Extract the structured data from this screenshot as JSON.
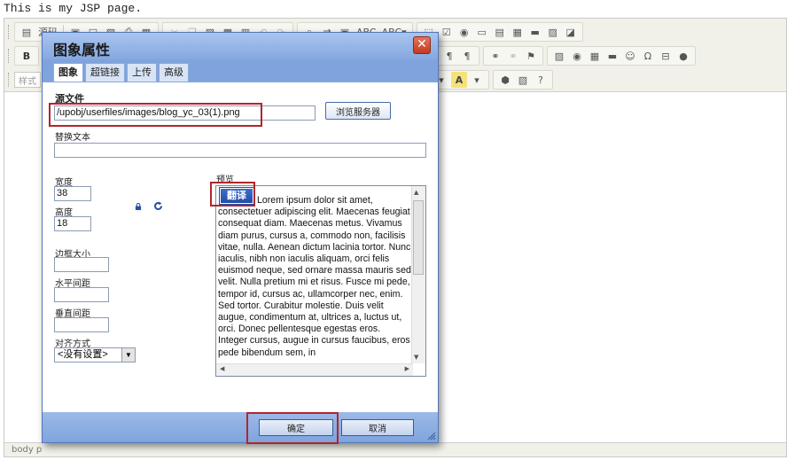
{
  "page": {
    "heading": "This is my JSP page."
  },
  "editor": {
    "toolbar": {
      "source_label": "源码",
      "style_combo": "样式",
      "bold_label": "B"
    },
    "status_text": "body p"
  },
  "dialog": {
    "title": "图象属性",
    "close_glyph": "✕",
    "tabs": [
      {
        "label": "图象"
      },
      {
        "label": "超链接"
      },
      {
        "label": "上传"
      },
      {
        "label": "高级"
      }
    ],
    "source": {
      "label": "源文件",
      "value": "/upobj/userfiles/images/blog_yc_03(1).png",
      "browse_label": "浏览服务器"
    },
    "alt": {
      "label": "替换文本",
      "value": ""
    },
    "width": {
      "label": "宽度",
      "value": "38"
    },
    "height": {
      "label": "高度",
      "value": "18"
    },
    "border": {
      "label": "边框大小",
      "value": ""
    },
    "hspace": {
      "label": "水平间距",
      "value": ""
    },
    "vspace": {
      "label": "垂直间距",
      "value": ""
    },
    "align": {
      "label": "对齐方式",
      "value": "<没有设置>"
    },
    "preview": {
      "label": "预览",
      "image_text": "翻译",
      "text": "Lorem ipsum dolor sit amet, consectetuer adipiscing elit. Maecenas feugiat consequat diam. Maecenas metus. Vivamus diam purus, cursus a, commodo non, facilisis vitae, nulla. Aenean dictum lacinia tortor. Nunc iaculis, nibh non iaculis aliquam, orci felis euismod neque, sed ornare massa mauris sed velit. Nulla pretium mi et risus. Fusce mi pede, tempor id, cursus ac, ullamcorper nec, enim. Sed tortor. Curabitur molestie. Duis velit augue, condimentum at, ultrices a, luctus ut, orci. Donec pellentesque egestas eros. Integer cursus, augue in cursus faucibus, eros pede bibendum sem, in"
    },
    "ok_label": "确定",
    "cancel_label": "取消"
  },
  "colors": {
    "dialog_frame": "#7fa4dd",
    "highlight_box": "#b0262c",
    "preview_image": "#1e4ca8"
  }
}
